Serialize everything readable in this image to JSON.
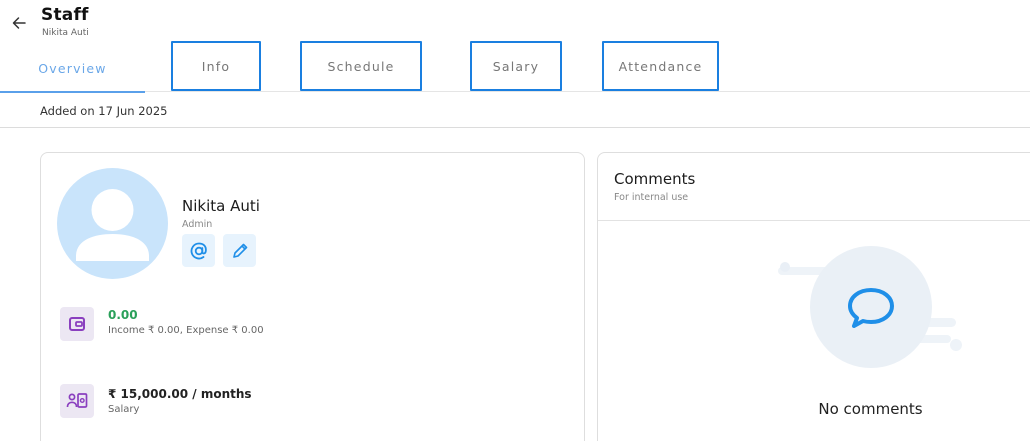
{
  "header": {
    "title": "Staff",
    "subtitle": "Nikita Auti",
    "back_icon": "arrow-left-icon"
  },
  "tabs": [
    {
      "label": "Overview",
      "active": true,
      "outlined": false
    },
    {
      "label": "Info",
      "active": false,
      "outlined": true
    },
    {
      "label": "Schedule",
      "active": false,
      "outlined": true
    },
    {
      "label": "Salary",
      "active": false,
      "outlined": true
    },
    {
      "label": "Attendance",
      "active": false,
      "outlined": true
    }
  ],
  "added_on": "Added on 17 Jun 2025",
  "profile": {
    "name": "Nikita Auti",
    "role": "Admin",
    "avatar_icon": "user-avatar-icon",
    "actions": [
      {
        "icon": "at-sign-icon"
      },
      {
        "icon": "pencil-icon"
      }
    ],
    "balance": {
      "icon": "wallet-icon",
      "value": "0.00",
      "detail": "Income ₹ 0.00, Expense ₹ 0.00"
    },
    "salary": {
      "icon": "salary-icon",
      "value": "₹ 15,000.00 / months",
      "label": "Salary"
    }
  },
  "comments": {
    "title": "Comments",
    "subtitle": "For internal use",
    "empty_icon": "speech-bubble-icon",
    "empty_text": "No comments"
  },
  "colors": {
    "accent": "#5aa0ea",
    "highlight_box": "#1a7fe0",
    "avatar_bg": "#c9e4fb",
    "positive": "#2aa05a",
    "icon_purple": "#8a3fbf",
    "bubble_blue": "#1f8fe8"
  }
}
